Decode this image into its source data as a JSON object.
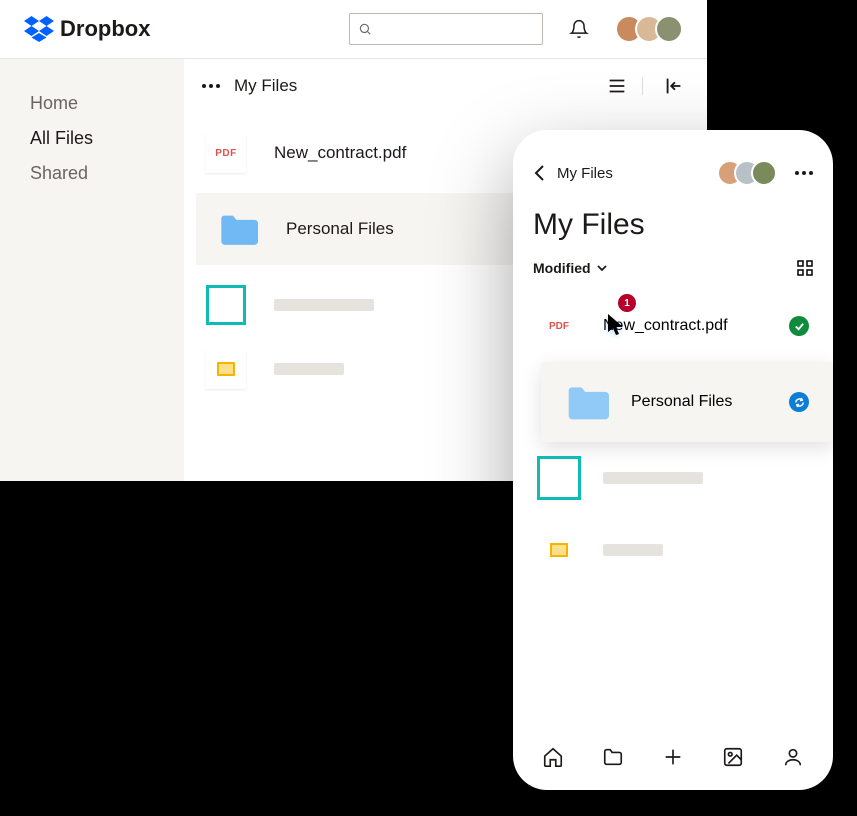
{
  "brand": "Dropbox",
  "sidebar": {
    "items": [
      {
        "label": "Home"
      },
      {
        "label": "All Files"
      },
      {
        "label": "Shared"
      }
    ]
  },
  "desktop": {
    "breadcrumb": "My Files",
    "files": [
      {
        "type": "pdf",
        "icon_label": "PDF",
        "name": "New_contract.pdf"
      },
      {
        "type": "folder",
        "name": "Personal Files"
      },
      {
        "type": "image",
        "name": ""
      },
      {
        "type": "slides",
        "name": ""
      }
    ],
    "cursor_badge": "1"
  },
  "mobile": {
    "breadcrumb": "My Files",
    "title": "My Files",
    "sort_label": "Modified",
    "files": [
      {
        "type": "pdf",
        "icon_label": "PDF",
        "name": "New_contract.pdf",
        "status": "synced"
      },
      {
        "type": "folder",
        "name": "Personal Files",
        "status": "syncing"
      },
      {
        "type": "image",
        "name": ""
      },
      {
        "type": "slides",
        "name": ""
      }
    ]
  }
}
